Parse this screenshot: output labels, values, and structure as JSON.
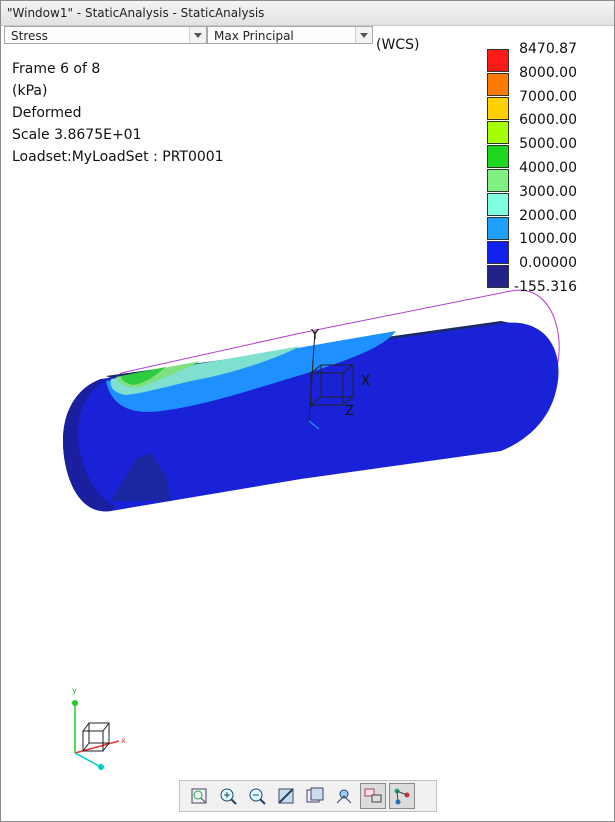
{
  "window": {
    "title": "\"Window1\" - StaticAnalysis - StaticAnalysis"
  },
  "selectors": {
    "quantity": "Stress",
    "component": "Max Principal"
  },
  "coordinate_system": "(WCS)",
  "info": {
    "frame": "Frame 6 of 8",
    "units": "(kPa)",
    "mode": "Deformed",
    "scale": "Scale  3.8675E+01",
    "loadset": "Loadset:MyLoadSet :  PRT0001"
  },
  "legend": {
    "labels": [
      "8470.87",
      "8000.00",
      "7000.00",
      "6000.00",
      "5000.00",
      "4000.00",
      "3000.00",
      "2000.00",
      "1000.00",
      "0.00000",
      "-155.316"
    ],
    "colors": [
      "#ff1a1a",
      "#ff7a00",
      "#ffd000",
      "#a6ff00",
      "#1fd61f",
      "#80f080",
      "#80ffe0",
      "#1ea0ff",
      "#1020ee",
      "#222288"
    ]
  },
  "axes": {
    "x": "X",
    "y": "Y",
    "z": "Z",
    "mini_x": "x",
    "mini_y": "y"
  },
  "toolbar": [
    {
      "name": "refit-icon"
    },
    {
      "name": "zoom-in-icon"
    },
    {
      "name": "zoom-out-icon"
    },
    {
      "name": "repaint-icon"
    },
    {
      "name": "display-style-icon"
    },
    {
      "name": "saved-view-icon"
    },
    {
      "name": "view-manager-icon"
    },
    {
      "name": "model-display-icon"
    }
  ]
}
